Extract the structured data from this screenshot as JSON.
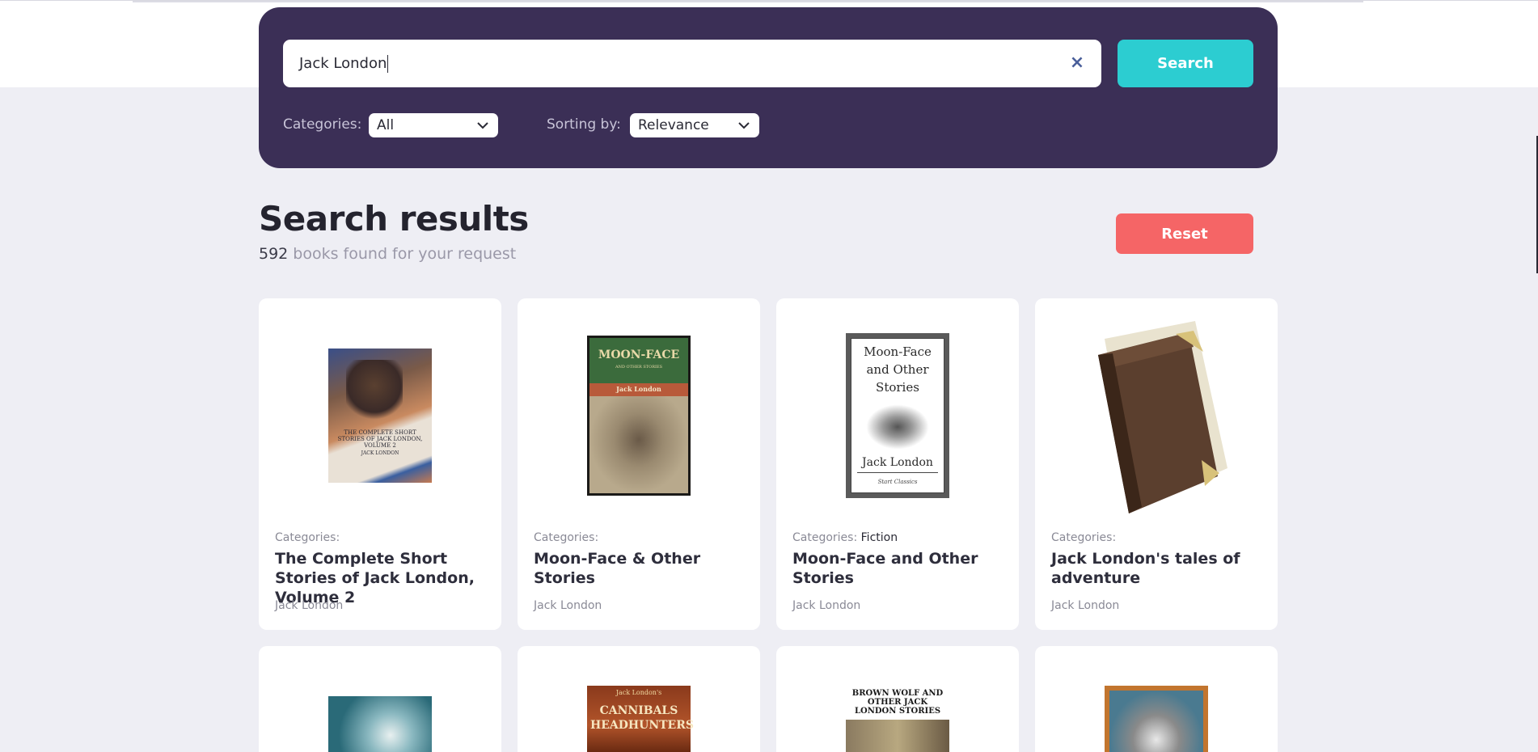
{
  "search": {
    "query": "Jack London",
    "clear_icon": "close-icon",
    "button_label": "Search",
    "categories_label": "Categories:",
    "categories_value": "All",
    "sorting_label": "Sorting by:",
    "sorting_value": "Relevance"
  },
  "results": {
    "title": "Search results",
    "count": "592",
    "count_suffix": " books found for your request",
    "reset_label": "Reset"
  },
  "books": [
    {
      "categories_label": "Categories:",
      "category": "",
      "title": "The Complete Short Stories of Jack London, Volume 2",
      "author": "Jack London",
      "cover_text": "THE COMPLETE SHORT STORIES OF JACK LONDON, VOLUME 2",
      "cover_author": "JACK LONDON"
    },
    {
      "categories_label": "Categories:",
      "category": "",
      "title": "Moon-Face & Other Stories",
      "author": "Jack London",
      "cover_text": "MOON-FACE",
      "cover_sub": "AND OTHER STORIES",
      "cover_author": "Jack London"
    },
    {
      "categories_label": "Categories:",
      "category": "Fiction",
      "title": "Moon-Face and Other Stories",
      "author": "Jack London",
      "cover_text": "Moon-Face and Other Stories",
      "cover_author": "Jack London",
      "cover_publisher": "Start Classics"
    },
    {
      "categories_label": "Categories:",
      "category": "",
      "title": "Jack London's tales of adventure",
      "author": "Jack London"
    }
  ],
  "second_row_covers": [
    {
      "cover_text": ""
    },
    {
      "cover_text": "CANNIBALS HEADHUNTERS",
      "cover_author": "Jack London's"
    },
    {
      "cover_text": "BROWN WOLF AND OTHER JACK LONDON STORIES"
    },
    {
      "cover_text": ""
    }
  ],
  "colors": {
    "panel": "#3b2f56",
    "search_button": "#2ccdd1",
    "reset_button": "#f56566",
    "page_bg": "#eeeef4"
  }
}
